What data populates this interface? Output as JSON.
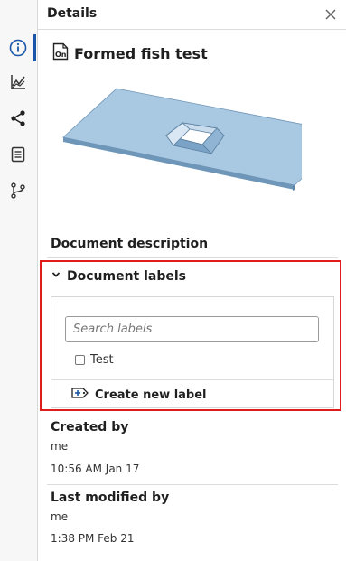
{
  "header": {
    "title": "Details",
    "close_icon": "close-icon"
  },
  "rail": {
    "items": [
      {
        "icon": "info-icon",
        "active": true
      },
      {
        "icon": "chart-line-icon",
        "active": false
      },
      {
        "icon": "share-icon",
        "active": false
      },
      {
        "icon": "document-list-icon",
        "active": false
      },
      {
        "icon": "branch-icon",
        "active": false
      }
    ],
    "accent_color": "#1a56a8"
  },
  "document": {
    "icon": "onshape-document-icon",
    "title": "Formed fish test"
  },
  "description": {
    "label": "Document description"
  },
  "labels": {
    "header": "Document labels",
    "search_placeholder": "Search labels",
    "items": [
      {
        "label": "Test",
        "checked": false
      }
    ],
    "create_label": "Create new label",
    "highlight_color": "#e01b1b"
  },
  "created": {
    "label": "Created by",
    "user": "me",
    "time": "10:56 AM Jan 17"
  },
  "modified": {
    "label": "Last modified by",
    "user": "me",
    "time": "1:38 PM Feb 21"
  }
}
